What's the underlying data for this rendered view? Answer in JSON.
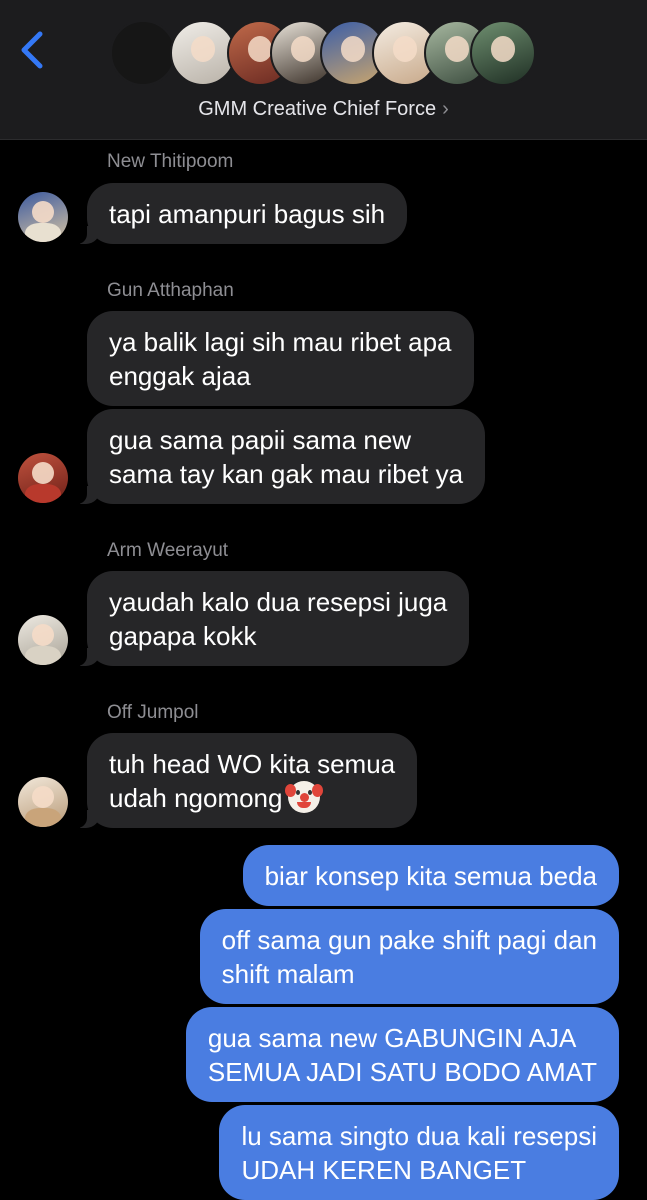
{
  "header": {
    "title": "GMM Creative Chief Force",
    "title_chevron": "›",
    "back_icon": "chevron-left-icon",
    "accent": "#3478f6",
    "members": [
      {
        "name": "blank",
        "color": "#161616"
      },
      {
        "name": "member-1",
        "color": "#d9d4cc"
      },
      {
        "name": "member-2",
        "color": "#8a3a30"
      },
      {
        "name": "member-3",
        "color": "#5a4a3c"
      },
      {
        "name": "member-4",
        "color": "#b8a17e"
      },
      {
        "name": "member-5",
        "color": "#d8c6b0"
      },
      {
        "name": "member-6",
        "color": "#556b55"
      },
      {
        "name": "member-7",
        "color": "#3f5a48"
      }
    ]
  },
  "messages": [
    {
      "sender": "New Thitipoom",
      "lines": [
        "tapi amanpuri bagus sih"
      ],
      "avatar_color": "#c9b59a"
    },
    {
      "sender": "Gun Atthaphan",
      "lines": [
        "ya balik lagi sih mau ribet apa",
        "enggak ajaa"
      ]
    },
    {
      "lines": [
        "gua sama papii sama new",
        "sama tay kan gak mau ribet ya"
      ],
      "avatar_color": "#a63a2e"
    },
    {
      "sender": "Arm Weerayut",
      "lines": [
        "yaudah kalo dua resepsi juga",
        "gapapa kokk"
      ],
      "avatar_color": "#cfcabf"
    },
    {
      "sender": "Off Jumpol",
      "lines": [
        "tuh head WO kita semua",
        "udah ngomong"
      ],
      "emoji": "clown-face-emoji",
      "avatar_color": "#d6c3a6"
    }
  ],
  "outgoing": [
    {
      "lines": [
        "biar konsep kita semua beda"
      ]
    },
    {
      "lines": [
        "off sama gun pake shift pagi dan",
        "shift malam"
      ]
    },
    {
      "lines": [
        "gua sama new GABUNGIN AJA",
        "SEMUA JADI SATU BODO AMAT"
      ]
    },
    {
      "lines": [
        "lu sama singto dua kali resepsi",
        "UDAH KEREN BANGET"
      ]
    }
  ],
  "colors": {
    "incoming_bubble": "#262628",
    "outgoing_bubble": "#4a7de1",
    "sender_name": "#8e8e93",
    "background": "#000000"
  }
}
